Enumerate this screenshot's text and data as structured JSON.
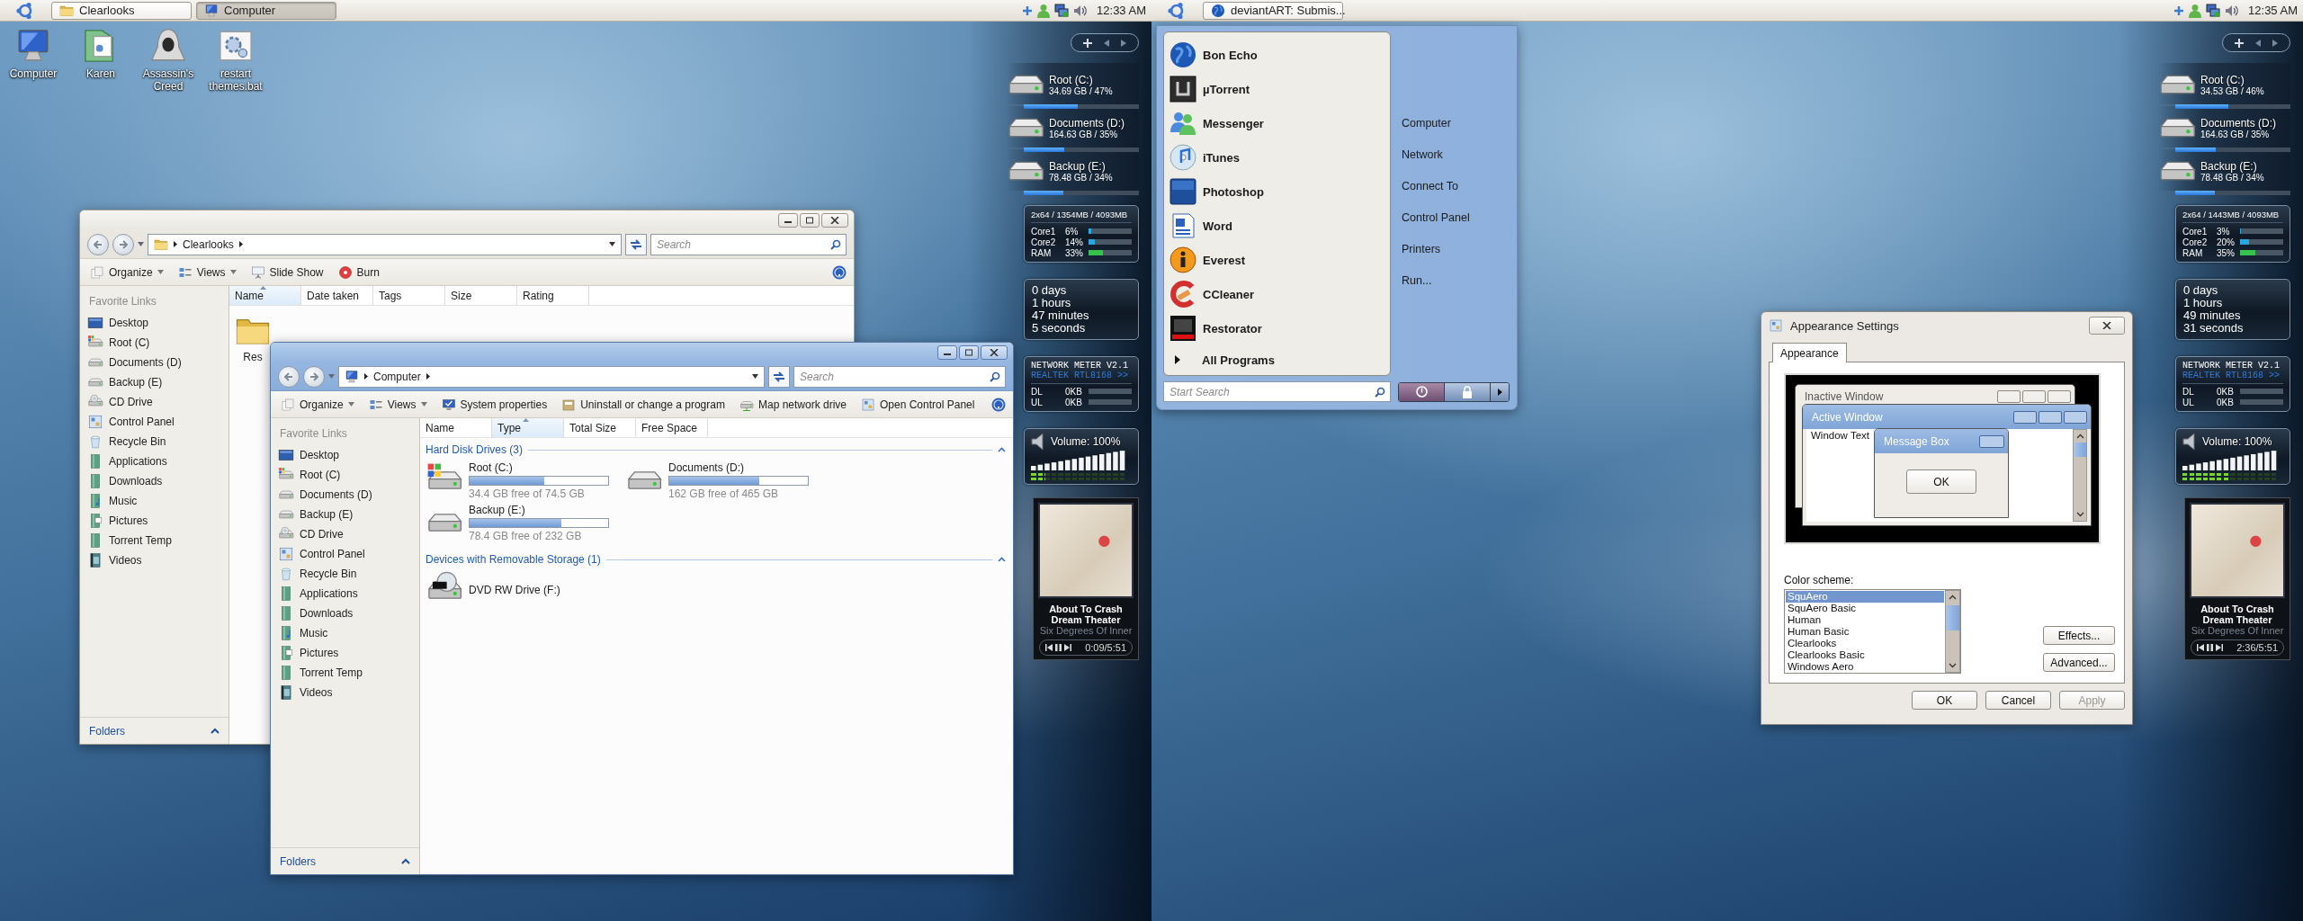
{
  "monitors": [
    {
      "panel": {
        "tasks": [
          {
            "label": "Clearlooks",
            "selected": false
          },
          {
            "label": "Computer",
            "selected": true
          }
        ],
        "clock": "12:33 AM"
      },
      "desktop_icons": [
        {
          "label": "Computer"
        },
        {
          "label": "Karen"
        },
        {
          "label": "Assassin's Creed"
        },
        {
          "label": "restart themes.bat"
        }
      ],
      "windows": [
        {
          "kind": "explorer",
          "active": false,
          "address": "Clearlooks",
          "search_placeholder": "Search",
          "toolbar": [
            {
              "label": "Organize",
              "dropdown": true
            },
            {
              "label": "Views",
              "dropdown": true
            },
            {
              "label": "Slide Show",
              "dropdown": false
            },
            {
              "label": "Burn",
              "dropdown": false
            }
          ],
          "sidebar": {
            "heading": "Favorite Links",
            "items": [
              {
                "label": "Desktop"
              },
              {
                "label": "Root (C)"
              },
              {
                "label": "Documents (D)"
              },
              {
                "label": "Backup (E)"
              },
              {
                "label": "CD Drive"
              },
              {
                "label": "Control Panel"
              },
              {
                "label": "Recycle Bin"
              },
              {
                "label": "Applications"
              },
              {
                "label": "Downloads"
              },
              {
                "label": "Music"
              },
              {
                "label": "Pictures"
              },
              {
                "label": "Torrent Temp"
              },
              {
                "label": "Videos"
              }
            ],
            "footer": "Folders"
          },
          "columns": [
            {
              "label": "Name",
              "sorted": true
            },
            {
              "label": "Date taken",
              "sorted": false
            },
            {
              "label": "Tags",
              "sorted": false
            },
            {
              "label": "Size",
              "sorted": false
            },
            {
              "label": "Rating",
              "sorted": false
            }
          ],
          "items": [
            {
              "label": "Res"
            }
          ]
        },
        {
          "kind": "explorer",
          "active": true,
          "address": "Computer",
          "search_placeholder": "Search",
          "toolbar": [
            {
              "label": "Organize",
              "dropdown": true
            },
            {
              "label": "Views",
              "dropdown": true
            },
            {
              "label": "System properties",
              "dropdown": false
            },
            {
              "label": "Uninstall or change a program",
              "dropdown": false
            },
            {
              "label": "Map network drive",
              "dropdown": false
            },
            {
              "label": "Open Control Panel",
              "dropdown": false
            }
          ],
          "sidebar": {
            "heading": "Favorite Links",
            "items": [
              {
                "label": "Desktop"
              },
              {
                "label": "Root (C)"
              },
              {
                "label": "Documents (D)"
              },
              {
                "label": "Backup (E)"
              },
              {
                "label": "CD Drive"
              },
              {
                "label": "Control Panel"
              },
              {
                "label": "Recycle Bin"
              },
              {
                "label": "Applications"
              },
              {
                "label": "Downloads"
              },
              {
                "label": "Music"
              },
              {
                "label": "Pictures"
              },
              {
                "label": "Torrent Temp"
              },
              {
                "label": "Videos"
              }
            ],
            "footer": "Folders"
          },
          "columns": [
            {
              "label": "Name",
              "sorted": false
            },
            {
              "label": "Type",
              "sorted": true
            },
            {
              "label": "Total Size",
              "sorted": false
            },
            {
              "label": "Free Space",
              "sorted": false
            }
          ],
          "groups": [
            {
              "title": "Hard Disk Drives (3)",
              "items": [
                {
                  "label": "Root (C:)",
                  "level": 0.54,
                  "detail": "34.4 GB free of 74.5 GB"
                },
                {
                  "label": "Documents (D:)",
                  "level": 0.65,
                  "detail": "162 GB free of 465 GB"
                },
                {
                  "label": "Backup (E:)",
                  "level": 0.66,
                  "detail": "78.4 GB free of 232 GB"
                }
              ]
            },
            {
              "title": "Devices with Removable Storage (1)",
              "items": [
                {
                  "label": "DVD RW Drive (F:)"
                }
              ]
            }
          ]
        }
      ],
      "gadgets": {
        "drives": [
          {
            "name": "Root (C:)",
            "detail": "34.69 GB / 47%",
            "level": 0.47
          },
          {
            "name": "Documents (D:)",
            "detail": "164.63 GB / 35%",
            "level": 0.35
          },
          {
            "name": "Backup (E:)",
            "detail": "78.48 GB / 34%",
            "level": 0.34
          }
        ],
        "cpu": {
          "header": "2x64 / 1354MB / 4093MB",
          "rows": [
            {
              "label": "Core1",
              "value": "6%",
              "level": 0.06,
              "color": "#2aa6e0"
            },
            {
              "label": "Core2",
              "value": "14%",
              "level": 0.14,
              "color": "#2aa6e0"
            },
            {
              "label": "RAM",
              "value": "33%",
              "level": 0.33,
              "color": "#36c24c"
            }
          ]
        },
        "uptime": [
          "0 days",
          "1 hours",
          "47 minutes",
          "5 seconds"
        ],
        "network": {
          "title": "NETWORK METER V2.1",
          "adapter": "REALTEK RTL8168 >>",
          "rows": [
            {
              "label": "DL",
              "value": "0KB"
            },
            {
              "label": "UL",
              "value": "0KB"
            }
          ]
        },
        "volume": {
          "label": "Volume: 100%",
          "peak": {
            "level": 0.15
          }
        },
        "media": {
          "title": "About To Crash",
          "artist": "Dream Theater",
          "album": "Six Degrees Of Inner",
          "time": "0:09/5:51"
        }
      }
    },
    {
      "panel": {
        "tasks": [
          {
            "label": "deviantART: Submis...",
            "selected": false
          }
        ],
        "clock": "12:35 AM"
      },
      "start_menu": {
        "programs": [
          {
            "label": "Bon Echo"
          },
          {
            "label": "µTorrent"
          },
          {
            "label": "Messenger"
          },
          {
            "label": "iTunes"
          },
          {
            "label": "Photoshop"
          },
          {
            "label": "Word"
          },
          {
            "label": "Everest"
          },
          {
            "label": "CCleaner"
          },
          {
            "label": "Restorator"
          }
        ],
        "all_programs": "All Programs",
        "places": [
          "Computer",
          "Network",
          "Connect To",
          "Control Panel",
          "Printers",
          "Run..."
        ],
        "search_placeholder": "Start Search"
      },
      "dialog": {
        "title": "Appearance Settings",
        "tabs": [
          {
            "label": "Appearance",
            "selected": true
          }
        ],
        "preview": {
          "inactive_title": "Inactive Window",
          "active_title": "Active Window",
          "window_text": "Window Text",
          "message_title": "Message Box",
          "message_button": "OK"
        },
        "scheme_label": "Color scheme:",
        "schemes": [
          {
            "label": "SquAero",
            "selected": true
          },
          {
            "label": "SquAero Basic",
            "selected": false
          },
          {
            "label": "Human",
            "selected": false
          },
          {
            "label": "Human Basic",
            "selected": false
          },
          {
            "label": "Clearlooks",
            "selected": false
          },
          {
            "label": "Clearlooks Basic",
            "selected": false
          },
          {
            "label": "Windows Aero",
            "selected": false
          }
        ],
        "side_buttons": [
          "Effects...",
          "Advanced..."
        ],
        "buttons": [
          {
            "label": "OK",
            "disabled": false
          },
          {
            "label": "Cancel",
            "disabled": false
          },
          {
            "label": "Apply",
            "disabled": true
          }
        ]
      },
      "gadgets": {
        "drives": [
          {
            "name": "Root (C:)",
            "detail": "34.53 GB / 46%",
            "level": 0.46
          },
          {
            "name": "Documents (D:)",
            "detail": "164.63 GB / 35%",
            "level": 0.35
          },
          {
            "name": "Backup (E:)",
            "detail": "78.48 GB / 34%",
            "level": 0.34
          }
        ],
        "cpu": {
          "header": "2x64 / 1443MB / 4093MB",
          "rows": [
            {
              "label": "Core1",
              "value": "3%",
              "level": 0.03,
              "color": "#2aa6e0"
            },
            {
              "label": "Core2",
              "value": "20%",
              "level": 0.2,
              "color": "#2aa6e0"
            },
            {
              "label": "RAM",
              "value": "35%",
              "level": 0.35,
              "color": "#36c24c"
            }
          ]
        },
        "uptime": [
          "0 days",
          "1 hours",
          "49 minutes",
          "31 seconds"
        ],
        "network": {
          "title": "NETWORK METER V2.1",
          "adapter": "REALTEK RTL8168 >>",
          "rows": [
            {
              "label": "DL",
              "value": "0KB"
            },
            {
              "label": "UL",
              "value": "0KB"
            }
          ]
        },
        "volume": {
          "label": "Volume: 100%",
          "peak": {
            "level": 0.5
          }
        },
        "media": {
          "title": "About To Crash",
          "artist": "Dream Theater",
          "album": "Six Degrees Of Inner",
          "time": "2:36/5:51"
        }
      }
    }
  ]
}
